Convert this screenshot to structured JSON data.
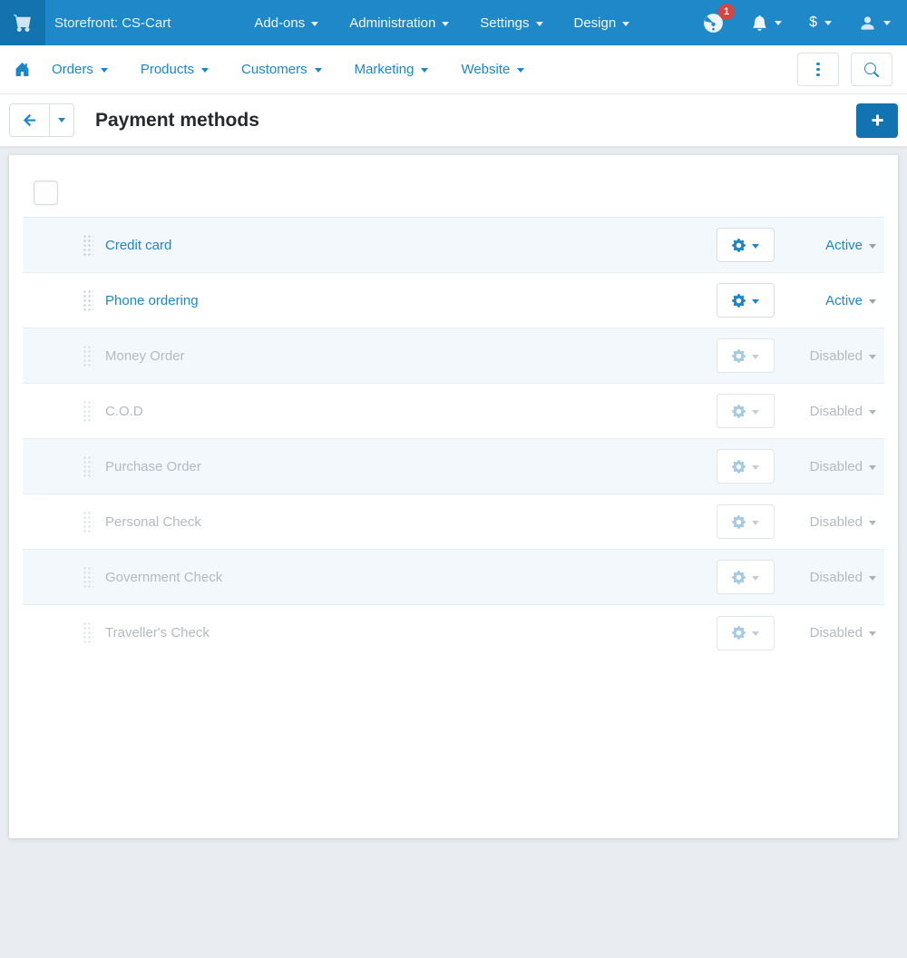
{
  "topbar": {
    "brand": "Storefront: CS-Cart",
    "menus": [
      {
        "label": "Add-ons"
      },
      {
        "label": "Administration"
      },
      {
        "label": "Settings"
      },
      {
        "label": "Design"
      }
    ],
    "notifications_badge": "1",
    "currency_label": "$"
  },
  "navbar": {
    "items": [
      {
        "label": "Orders"
      },
      {
        "label": "Products"
      },
      {
        "label": "Customers"
      },
      {
        "label": "Marketing"
      },
      {
        "label": "Website"
      }
    ]
  },
  "page_header": {
    "title": "Payment methods"
  },
  "payment_list": {
    "rows": [
      {
        "name": "Credit card",
        "status": "Active",
        "enabled": true
      },
      {
        "name": "Phone ordering",
        "status": "Active",
        "enabled": true
      },
      {
        "name": "Money Order",
        "status": "Disabled",
        "enabled": false
      },
      {
        "name": "C.O.D",
        "status": "Disabled",
        "enabled": false
      },
      {
        "name": "Purchase Order",
        "status": "Disabled",
        "enabled": false
      },
      {
        "name": "Personal Check",
        "status": "Disabled",
        "enabled": false
      },
      {
        "name": "Government Check",
        "status": "Disabled",
        "enabled": false
      },
      {
        "name": "Traveller's Check",
        "status": "Disabled",
        "enabled": false
      }
    ]
  },
  "colors": {
    "topbar_bg": "#1e88c8",
    "topbar_square_bg": "#1273ae",
    "accent_blue": "#1b87c9",
    "add_button_bg": "#1173b0",
    "badge_red": "#d64541",
    "row_alt_bg": "#f2f8fc",
    "disabled_text": "#b4bac1",
    "page_bg": "#e9edf1"
  }
}
